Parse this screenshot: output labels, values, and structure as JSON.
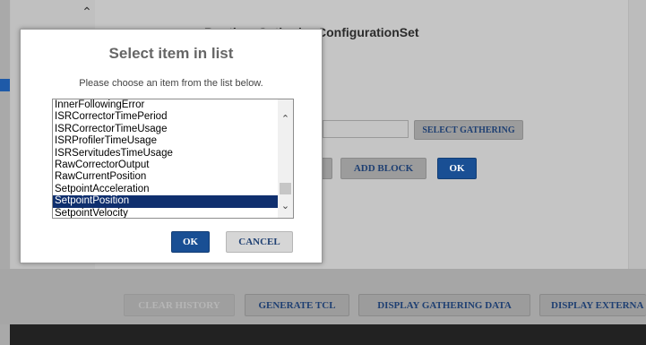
{
  "page": {
    "title": "Routine_GatheringConfigurationSet"
  },
  "background_buttons": {
    "select_gathering": "SELECT GATHERING",
    "add_block": "ADD BLOCK",
    "ok": "OK",
    "clear_history": "CLEAR HISTORY",
    "generate_tcl": "GENERATE TCL",
    "display_gathering_data": "DISPLAY GATHERING DATA",
    "display_external": "DISPLAY EXTERNA"
  },
  "dialog": {
    "title": "Select item in list",
    "description": "Please choose an item from the list below.",
    "items": [
      "InnerFollowingError",
      "ISRCorrectorTimePeriod",
      "ISRCorrectorTimeUsage",
      "ISRProfilerTimeUsage",
      "ISRServitudesTimeUsage",
      "RawCorrectorOutput",
      "RawCurrentPosition",
      "SetpointAcceleration",
      "SetpointPosition",
      "SetpointVelocity"
    ],
    "selected_item": "SetpointPosition",
    "ok_label": "OK",
    "cancel_label": "CANCEL"
  },
  "icons": {
    "scroll_up": "chevron-up-icon",
    "scroll_down": "chevron-down-icon",
    "page_scroll_up": "chevron-up-icon"
  },
  "colors": {
    "primary_button": "#194f94",
    "selected_row": "#0f2f6e",
    "secondary_button_text": "#1e3f72"
  }
}
